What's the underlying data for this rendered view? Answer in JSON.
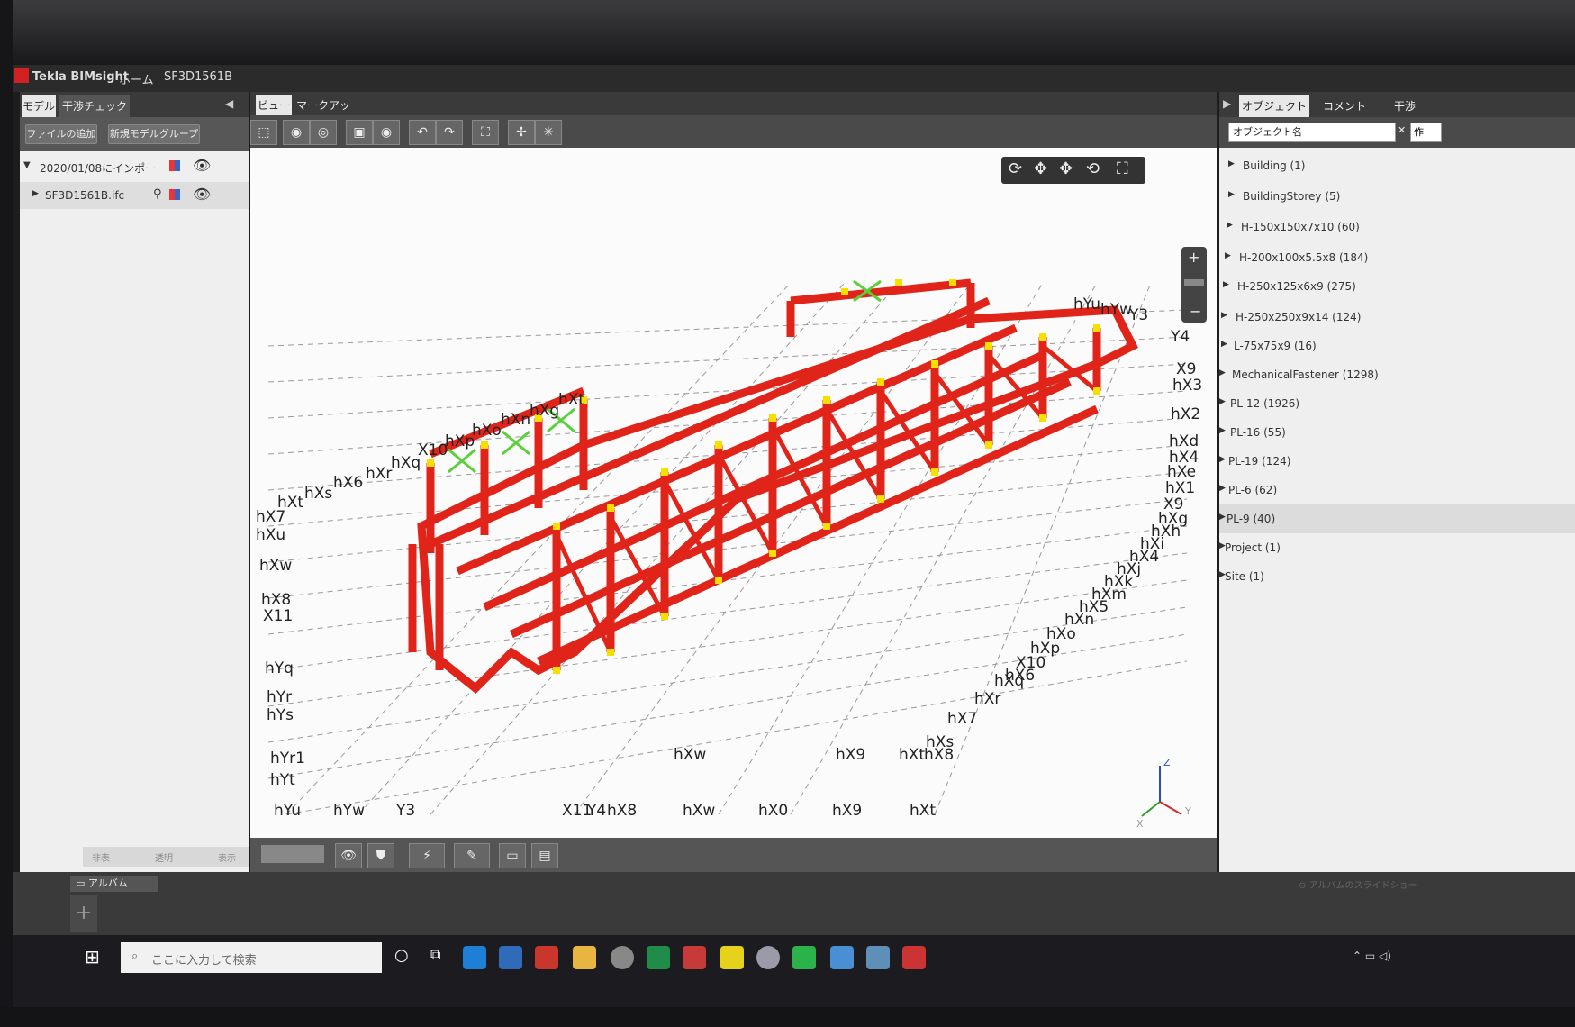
{
  "app": {
    "title": "Tekla BIMsight",
    "tab_home": "ホーム",
    "tab_project": "SF3D1561B"
  },
  "left_panel": {
    "tabs": [
      "モデル",
      "干渉チェック"
    ],
    "add_file_label": "ファイルの追加",
    "new_group_label": "新規モデルグループ",
    "tree": [
      {
        "label": "2020/01/08にインポー"
      },
      {
        "label": "SF3D1561B.ifc"
      }
    ],
    "footer_buttons": [
      "非表",
      "透明",
      "表示"
    ]
  },
  "view_panel": {
    "tabs": [
      "ビュー",
      "マークアップ"
    ],
    "grid_labels": [
      {
        "text": "hX7"
      },
      {
        "text": "hXt"
      },
      {
        "text": "hXs"
      },
      {
        "text": "hX6"
      },
      {
        "text": "hXr"
      },
      {
        "text": "hXq"
      },
      {
        "text": "X10"
      },
      {
        "text": "hXp"
      },
      {
        "text": "hXo"
      },
      {
        "text": "hXn"
      },
      {
        "text": "hXg"
      },
      {
        "text": "hXt"
      },
      {
        "text": "hYu"
      },
      {
        "text": "hYw"
      },
      {
        "text": "Y3"
      },
      {
        "text": "Y4"
      },
      {
        "text": "X9"
      },
      {
        "text": "hX3"
      },
      {
        "text": "hX2"
      },
      {
        "text": "hXd"
      },
      {
        "text": "hX4"
      },
      {
        "text": "hXe"
      },
      {
        "text": "hX1"
      },
      {
        "text": "X9"
      },
      {
        "text": "hXg"
      },
      {
        "text": "hXh"
      },
      {
        "text": "hXi"
      },
      {
        "text": "hX4"
      },
      {
        "text": "hXj"
      },
      {
        "text": "hXk"
      },
      {
        "text": "hXm"
      },
      {
        "text": "hX5"
      },
      {
        "text": "hXn"
      },
      {
        "text": "hXo"
      },
      {
        "text": "hXp"
      },
      {
        "text": "X10"
      },
      {
        "text": "hXq"
      },
      {
        "text": "hX6"
      },
      {
        "text": "hXr"
      },
      {
        "text": "hX7"
      },
      {
        "text": "hXs"
      },
      {
        "text": "hXt"
      },
      {
        "text": "hX8"
      },
      {
        "text": "hX9"
      },
      {
        "text": "hXw"
      },
      {
        "text": "hXu"
      },
      {
        "text": "hXw"
      },
      {
        "text": "hX8"
      },
      {
        "text": "X11"
      },
      {
        "text": "hYq"
      },
      {
        "text": "hYr"
      },
      {
        "text": "hYs"
      },
      {
        "text": "hYr1"
      },
      {
        "text": "hYt"
      },
      {
        "text": "hYu"
      },
      {
        "text": "hYw"
      },
      {
        "text": "Y3"
      },
      {
        "text": "X11"
      },
      {
        "text": "Y4"
      },
      {
        "text": "hX8"
      },
      {
        "text": "hXw"
      },
      {
        "text": "hX0"
      },
      {
        "text": "hX9"
      },
      {
        "text": "hXt"
      }
    ],
    "axis_z": "Z",
    "axis_y": "Y",
    "axis_x": "X"
  },
  "right_panel": {
    "tabs": [
      "オブジェクト",
      "コメント",
      "干渉"
    ],
    "filter_label": "オブジェクト名",
    "filter_extra": "作",
    "objects": [
      {
        "label": "Building (1)"
      },
      {
        "label": "BuildingStorey (5)"
      },
      {
        "label": "H-150x150x7x10 (60)"
      },
      {
        "label": "H-200x100x5.5x8 (184)"
      },
      {
        "label": "H-250x125x6x9 (275)"
      },
      {
        "label": "H-250x250x9x14 (124)"
      },
      {
        "label": "L-75x75x9 (16)"
      },
      {
        "label": "MechanicalFastener (1298)"
      },
      {
        "label": "PL-12 (1926)"
      },
      {
        "label": "PL-16 (55)"
      },
      {
        "label": "PL-19 (124)"
      },
      {
        "label": "PL-6 (62)"
      },
      {
        "label": "PL-9 (40)"
      },
      {
        "label": "Project (1)"
      },
      {
        "label": "Site (1)"
      }
    ]
  },
  "album": {
    "label": "アルバム",
    "slideshow_label": "アルバムのスライドショー"
  },
  "taskbar": {
    "search_placeholder": "ここに入力して検索"
  },
  "colors": {
    "model_red": "#e0241a",
    "node_yellow": "#f5e000",
    "brace_green": "#5ad13a"
  }
}
